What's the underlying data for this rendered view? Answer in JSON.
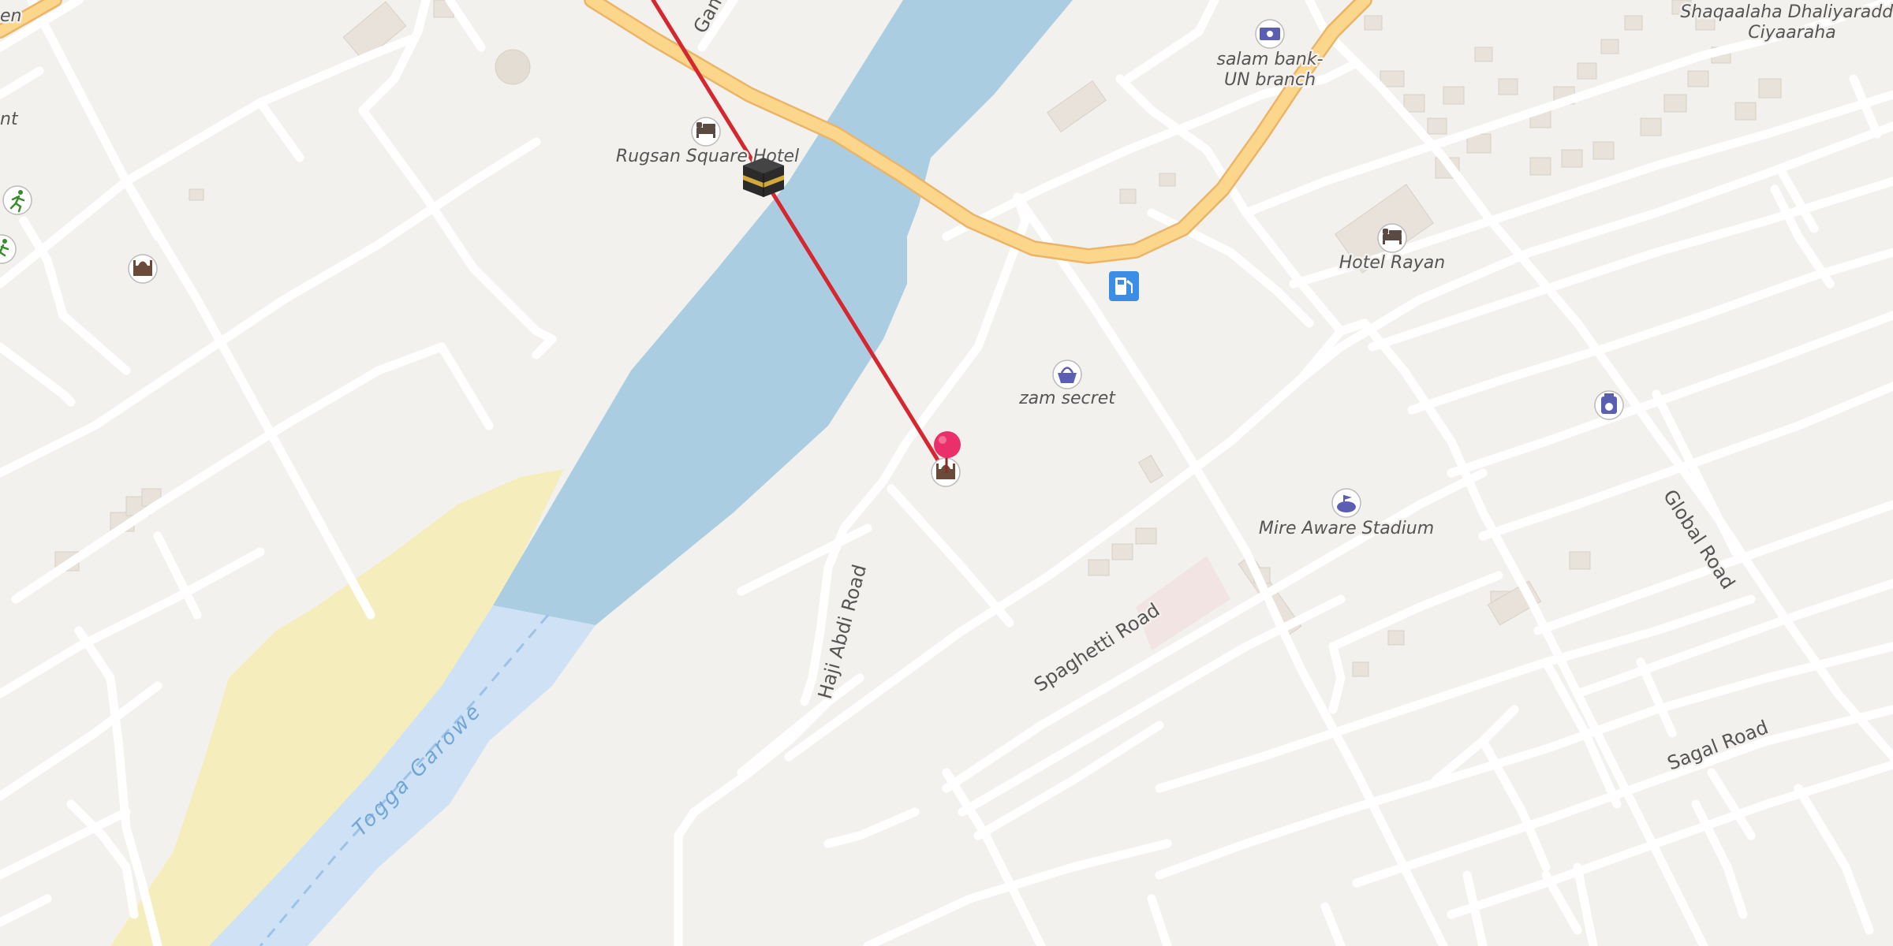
{
  "map": {
    "place_labels": {
      "rugsan_hotel": "Rugsan Square Hotel",
      "salam_bank_line1": "salam bank-",
      "salam_bank_line2": "UN branch",
      "hotel_rayan": "Hotel Rayan",
      "zam_secret": "zam secret",
      "stadium": "Mire Aware Stadium",
      "district_line1": "Shaqaalaha Dhaliyaradda",
      "district_line2": "Ciyaaraha",
      "edge_top_left": "en",
      "edge_left": "nt"
    },
    "road_labels": {
      "haji_abdi": "Haji Abdi Road",
      "spaghetti": "Spaghetti Road",
      "global": "Global Road",
      "sagal": "Sagal Road",
      "gam": "Gam"
    },
    "water_labels": {
      "river": "Togga Garowe"
    },
    "icons": {
      "hotel": "bed-icon",
      "bank": "banknote-icon",
      "fuel": "fuel-pump-icon",
      "shop": "basket-icon",
      "stadium": "stadium-icon",
      "camera": "camera-shop-icon",
      "mosque": "mosque-icon",
      "kaaba": "kaaba-icon",
      "marker": "location-pin-icon",
      "sport": "sport-runner-icon"
    },
    "colors": {
      "background": "#f3f1ee",
      "water": "#abcde2",
      "river_channel": "#cfe2f5",
      "sand": "#f5eebc",
      "major_road": "#fcd68b",
      "major_road_casing": "#eab569",
      "minor_road": "#ffffff",
      "qibla_line": "#d62630",
      "marker": "#ea2f6b",
      "poi_blue": "#5b5fb3"
    }
  }
}
